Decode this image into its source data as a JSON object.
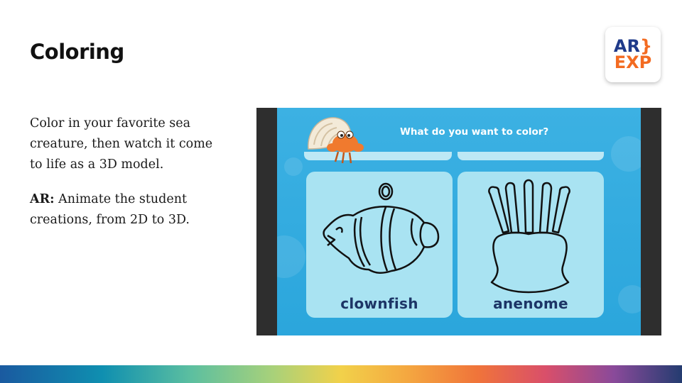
{
  "slide": {
    "title": "Coloring",
    "paragraph1": "Color in your favorite sea creature, then watch it come to life as a 3D model.",
    "ar_label": "AR:",
    "paragraph2": "Animate the student creations, from 2D to 3D."
  },
  "logo": {
    "line1": "AR",
    "brace": "}",
    "line2": "EXP",
    "colors": {
      "primary": "#1f3a8a",
      "accent": "#f36b21"
    }
  },
  "game": {
    "prompt": "What do you want to color?",
    "cards": [
      {
        "label": "clownfish",
        "icon": "clownfish-outline"
      },
      {
        "label": "anenome",
        "icon": "anemone-outline"
      }
    ],
    "mascot_icon": "hermit-crab-icon"
  }
}
